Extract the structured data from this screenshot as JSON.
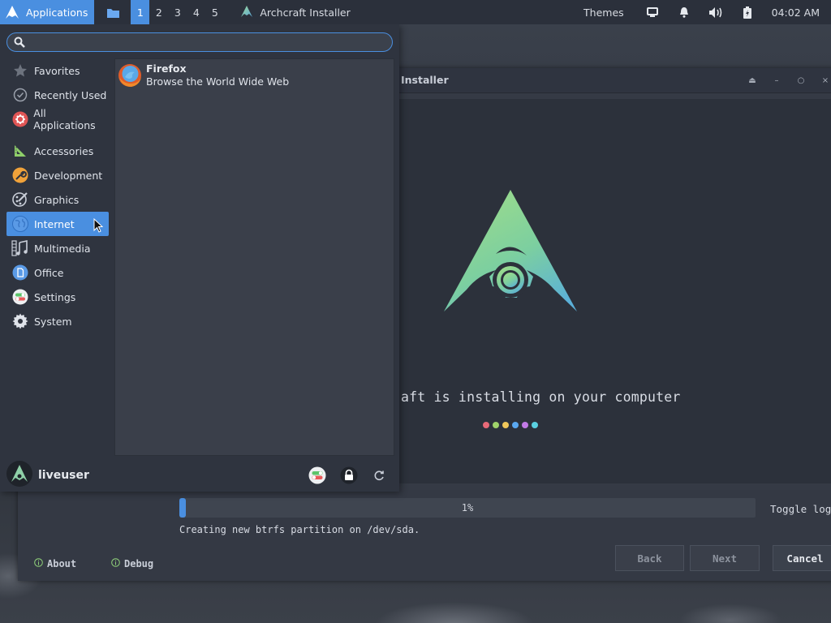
{
  "panel": {
    "applications_label": "Applications",
    "workspaces": [
      "1",
      "2",
      "3",
      "4",
      "5"
    ],
    "active_workspace": "1",
    "task_title": "Archcraft Installer",
    "themes_label": "Themes",
    "clock": "04:02 AM",
    "accent_color": "#4a8fe0"
  },
  "menu": {
    "search": {
      "value": "",
      "placeholder": ""
    },
    "categories": [
      {
        "label": "Favorites",
        "icon": "star-icon"
      },
      {
        "label": "Recently Used",
        "icon": "clock-icon"
      },
      {
        "label": "All Applications",
        "icon": "all-apps-icon"
      },
      {
        "label": "Accessories",
        "icon": "accessories-icon"
      },
      {
        "label": "Development",
        "icon": "wrench-icon"
      },
      {
        "label": "Graphics",
        "icon": "palette-icon"
      },
      {
        "label": "Internet",
        "icon": "globe-icon",
        "selected": true
      },
      {
        "label": "Multimedia",
        "icon": "music-icon"
      },
      {
        "label": "Office",
        "icon": "document-icon"
      },
      {
        "label": "Settings",
        "icon": "toggles-icon"
      },
      {
        "label": "System",
        "icon": "gear-icon"
      }
    ],
    "apps": [
      {
        "name": "Firefox",
        "description": "Browse the World Wide Web",
        "icon": "firefox-icon"
      }
    ],
    "username": "liveuser"
  },
  "installer": {
    "title_visible": "Installer",
    "message_visible": "aft is installing on your computer",
    "dot_colors": [
      "#e86a78",
      "#9fd36a",
      "#f0c75a",
      "#5aa8f0",
      "#c27ae6",
      "#5ad0e0"
    ],
    "progress_percent": 1,
    "progress_text": "1%",
    "toggle_log_label": "Toggle log",
    "status_text": "Creating new btrfs partition on /dev/sda.",
    "about_label": "About",
    "debug_label": "Debug",
    "back_label": "Back",
    "next_label": "Next",
    "cancel_label": "Cancel"
  }
}
